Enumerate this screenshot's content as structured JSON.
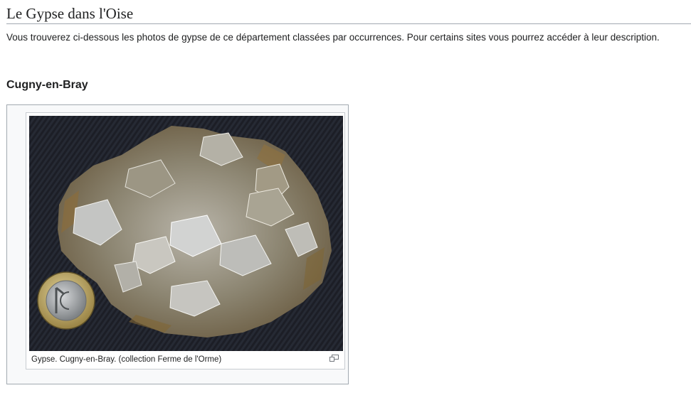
{
  "page": {
    "title": "Le Gypse dans l'Oise",
    "intro": "Vous trouverez ci-dessous les photos de gypse de ce département classées par occurrences. Pour certains sites vous pourrez accéder à leur description."
  },
  "sections": [
    {
      "heading": "Cugny-en-Bray",
      "figure": {
        "caption": "Gypse. Cugny-en-Bray. (collection Ferme de l'Orme)",
        "photo_subject": "gypsum crystal specimen beside a 1 euro coin on black fabric"
      }
    }
  ],
  "icons": {
    "enlarge": "magnify-icon"
  },
  "colors": {
    "text": "#202122",
    "rule": "#a2a9b1",
    "box_bg": "#f8f9fa",
    "photo_bg": "#1b1d24"
  }
}
